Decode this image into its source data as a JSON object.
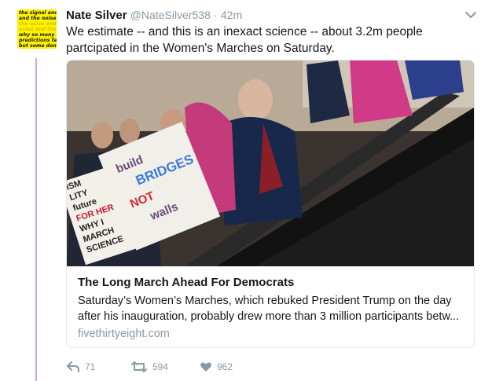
{
  "tweet": {
    "name": "Nate Silver",
    "handle": "@NateSilver538",
    "separator": "·",
    "time": "42m",
    "text": "We estimate -- and this is an inexact science -- about 3.2m people partcipated in the Women's Marches on Saturday.",
    "avatar_lines": [
      "the signal and the",
      "and the noise and",
      "the noise and the",
      "noise and the no",
      "why so many",
      "predictions fail--",
      "but some don't"
    ]
  },
  "card": {
    "title": "The Long March Ahead For Democrats",
    "description": "Saturday’s Women’s Marches, which rebuked President Trump on the day after his inauguration, probably drew more than 3 million participants betw...",
    "domain": "fivethirtyeight.com",
    "sign_left": [
      "ISM",
      "LITY",
      "future",
      "FOR HER",
      "WHY I",
      "MARCH",
      "SCIENCE"
    ],
    "sign_right": [
      "build",
      "BRIDGES",
      "NOT",
      "walls"
    ]
  },
  "actions": {
    "reply_count": "71",
    "retweet_count": "594",
    "like_count": "962"
  },
  "colors": {
    "accent_thread": "#c9a8f0",
    "avatar_bg": "#fff200",
    "muted": "#8899a6"
  },
  "icons": [
    "chevron-down-icon",
    "reply-icon",
    "retweet-icon",
    "heart-icon"
  ]
}
